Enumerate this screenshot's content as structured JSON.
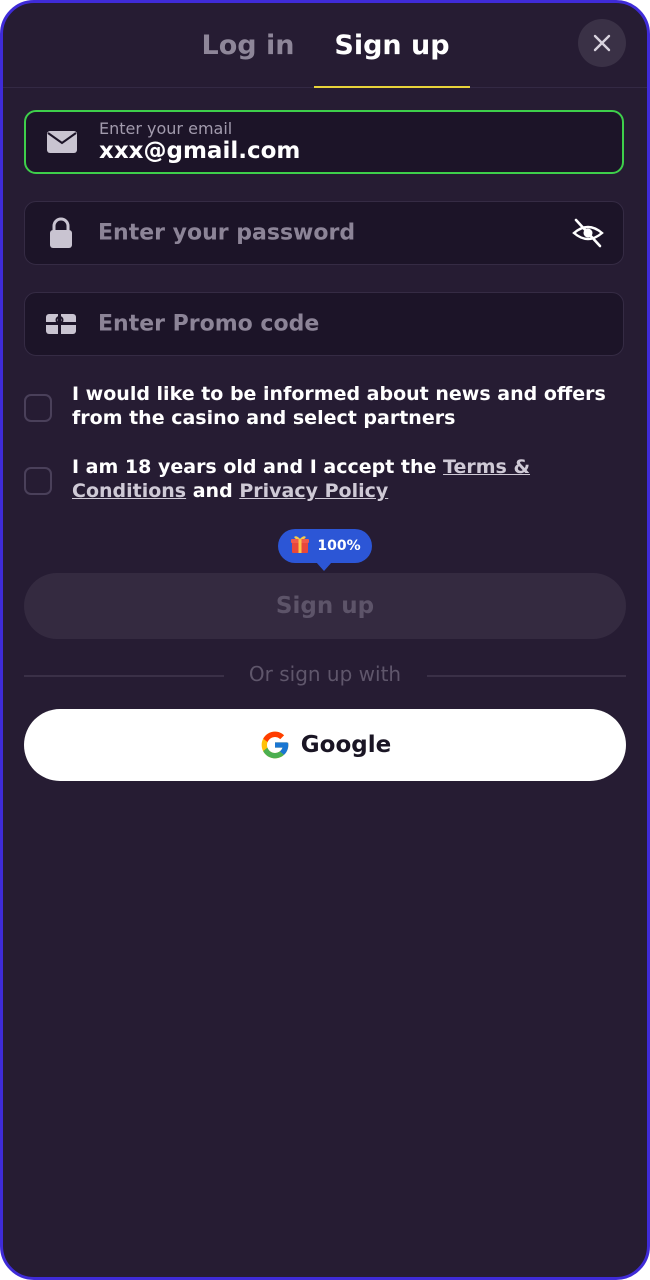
{
  "tabs": {
    "login": "Log in",
    "signup": "Sign up"
  },
  "email": {
    "label": "Enter your email",
    "value": "xxx@gmail.com"
  },
  "password": {
    "placeholder": "Enter your password"
  },
  "promo": {
    "placeholder": "Enter Promo code"
  },
  "consent": {
    "news_text": "I would like to be informed about news and offers from the casino and select partners",
    "age_prefix": "I am 18 years old and I accept the ",
    "terms_link": "Terms & Conditions",
    "and_text": " and ",
    "privacy_link": "Privacy Policy"
  },
  "bonus_badge": {
    "icon": "gift-icon",
    "value": "100%"
  },
  "signup_button": "Sign up",
  "divider": "Or sign up with",
  "google_button": "Google",
  "colors": {
    "frame_border": "#3f2bd8",
    "background": "#261c33",
    "active_field_border": "#3ecf4b",
    "tab_underline": "#e8d33a",
    "badge": "#2c56d6"
  }
}
